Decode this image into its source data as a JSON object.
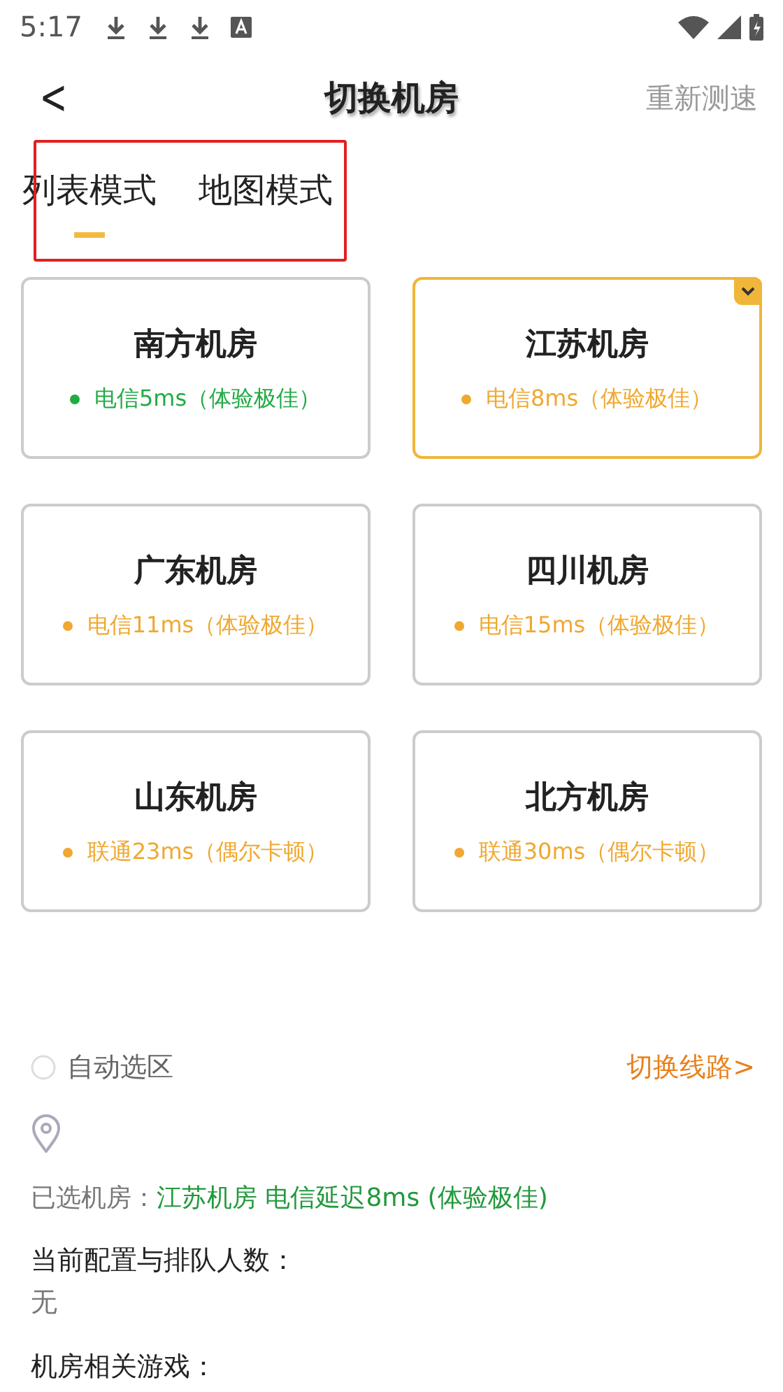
{
  "status_bar": {
    "time": "5:17"
  },
  "header": {
    "back": "<",
    "title": "切换机房",
    "action": "重新测速"
  },
  "tabs": [
    {
      "label": "列表模式",
      "selected": true
    },
    {
      "label": "地图模式",
      "selected": false
    }
  ],
  "rooms": [
    {
      "name": "南方机房",
      "latency": "电信5ms（体验极佳）",
      "color": "#22aa44",
      "selected": false
    },
    {
      "name": "江苏机房",
      "latency": "电信8ms（体验极佳）",
      "color": "#f0a830",
      "selected": true
    },
    {
      "name": "广东机房",
      "latency": "电信11ms（体验极佳）",
      "color": "#f0a830",
      "selected": false
    },
    {
      "name": "四川机房",
      "latency": "电信15ms（体验极佳）",
      "color": "#f0a830",
      "selected": false
    },
    {
      "name": "山东机房",
      "latency": "联通23ms（偶尔卡顿）",
      "color": "#f0a830",
      "selected": false
    },
    {
      "name": "北方机房",
      "latency": "联通30ms（偶尔卡顿）",
      "color": "#f0a830",
      "selected": false
    }
  ],
  "auto_select": {
    "label": "自动选区",
    "checked": false
  },
  "switch_line": "切换线路>",
  "selected_room": {
    "label": "已选机房：",
    "value": "江苏机房 电信延迟8ms (体验极佳)"
  },
  "config": {
    "label": "当前配置与排队人数：",
    "value": "无"
  },
  "games": {
    "label": "机房相关游戏："
  }
}
